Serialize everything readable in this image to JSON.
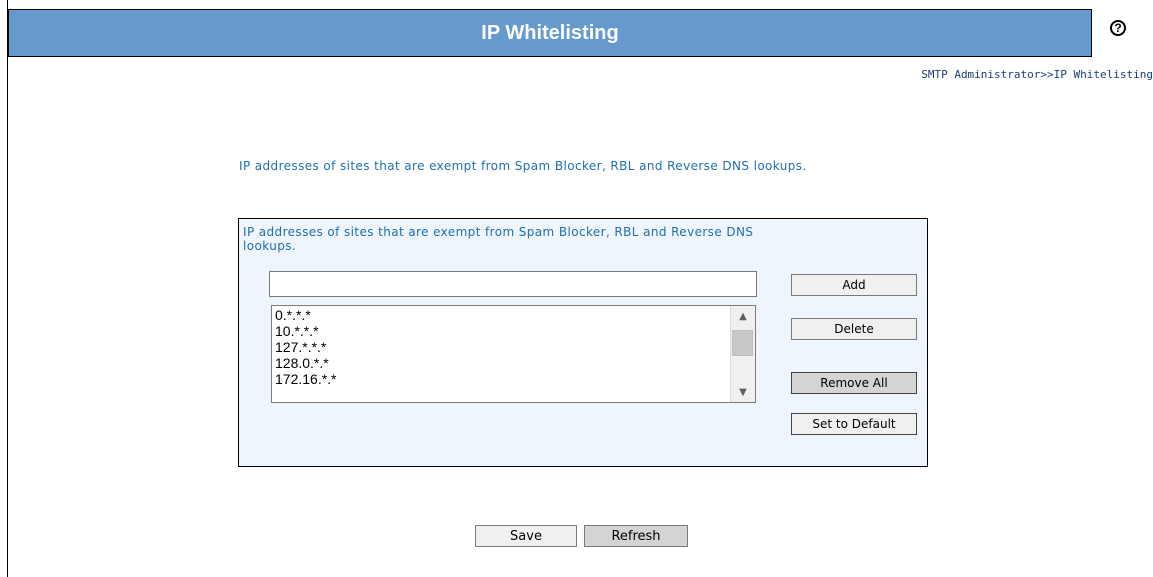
{
  "header": {
    "title": "IP Whitelisting",
    "help_glyph": "?",
    "help_icon": "question-circle-icon",
    "bar_color": "#6699cc"
  },
  "breadcrumb": "SMTP Administrator>>IP Whitelisting",
  "description": "IP addresses of sites that are exempt from Spam Blocker, RBL and Reverse DNS lookups.",
  "panel": {
    "description": "IP addresses of sites that are exempt from Spam Blocker, RBL and Reverse DNS lookups.",
    "input_value": "",
    "list_items": [
      "0.*.*.*",
      "10.*.*.*",
      "127.*.*.*",
      "128.0.*.*",
      "172.16.*.*"
    ],
    "buttons": {
      "add": "Add",
      "delete": "Delete",
      "remove_all": "Remove All",
      "set_default": "Set to Default"
    },
    "scroll_up_glyph": "▲",
    "scroll_down_glyph": "▼"
  },
  "footer": {
    "save": "Save",
    "refresh": "Refresh"
  },
  "colors": {
    "accent": "#6699cc",
    "link_text": "#1f6fb2",
    "panel_bg": "#eef5fc"
  }
}
